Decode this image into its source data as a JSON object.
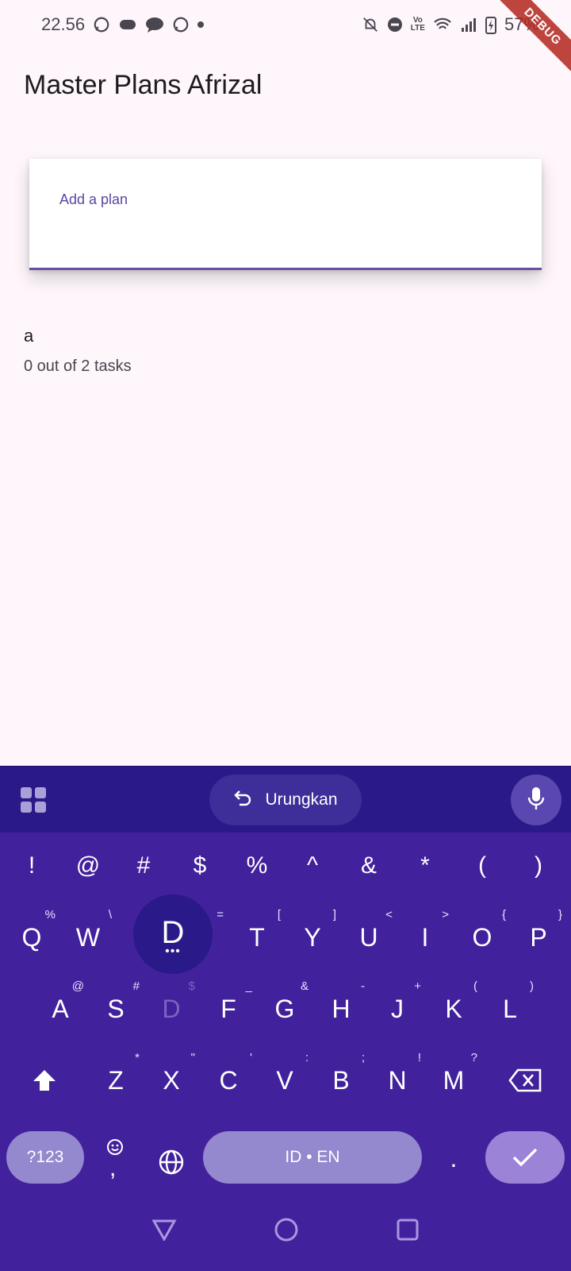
{
  "status_bar": {
    "time": "22.56",
    "battery": "57%",
    "debug_label": "DEBUG"
  },
  "app": {
    "title": "Master Plans Afrizal"
  },
  "plan_input": {
    "placeholder": "Add a plan",
    "value": ""
  },
  "plans": [
    {
      "name": "a",
      "progress": "0 out of 2 tasks"
    }
  ],
  "keyboard": {
    "undo_label": "Urungkan",
    "symbol_key": "?123",
    "space_label": "ID • EN",
    "period_key": ".",
    "comma_key": ",",
    "popup_key": "D",
    "row_symbols": [
      "!",
      "@",
      "#",
      "$",
      "%",
      "^",
      "&",
      "*",
      "(",
      ")"
    ],
    "row1": [
      {
        "key": "Q",
        "hint": "%"
      },
      {
        "key": "W",
        "hint": "\\"
      },
      {
        "key": "",
        "hint": ""
      },
      {
        "key": "",
        "hint": "="
      },
      {
        "key": "T",
        "hint": "["
      },
      {
        "key": "Y",
        "hint": "]"
      },
      {
        "key": "U",
        "hint": "<"
      },
      {
        "key": "I",
        "hint": ">"
      },
      {
        "key": "O",
        "hint": "{"
      },
      {
        "key": "P",
        "hint": "}"
      }
    ],
    "row2": [
      {
        "key": "A",
        "hint": "@"
      },
      {
        "key": "S",
        "hint": "#"
      },
      {
        "key": "D",
        "hint": "$"
      },
      {
        "key": "F",
        "hint": "_"
      },
      {
        "key": "G",
        "hint": "&"
      },
      {
        "key": "H",
        "hint": "-"
      },
      {
        "key": "J",
        "hint": "+"
      },
      {
        "key": "K",
        "hint": "("
      },
      {
        "key": "L",
        "hint": ")"
      }
    ],
    "row3": [
      {
        "key": "Z",
        "hint": "*"
      },
      {
        "key": "X",
        "hint": "\""
      },
      {
        "key": "C",
        "hint": "'"
      },
      {
        "key": "V",
        "hint": ":"
      },
      {
        "key": "B",
        "hint": ";"
      },
      {
        "key": "N",
        "hint": "!"
      },
      {
        "key": "M",
        "hint": "?"
      }
    ]
  },
  "colors": {
    "background": "#fef6fb",
    "accent": "#6750a4",
    "keyboard_bg": "#42219c",
    "keyboard_toolbar": "#2a1988",
    "key_pill": "#9488ce"
  }
}
